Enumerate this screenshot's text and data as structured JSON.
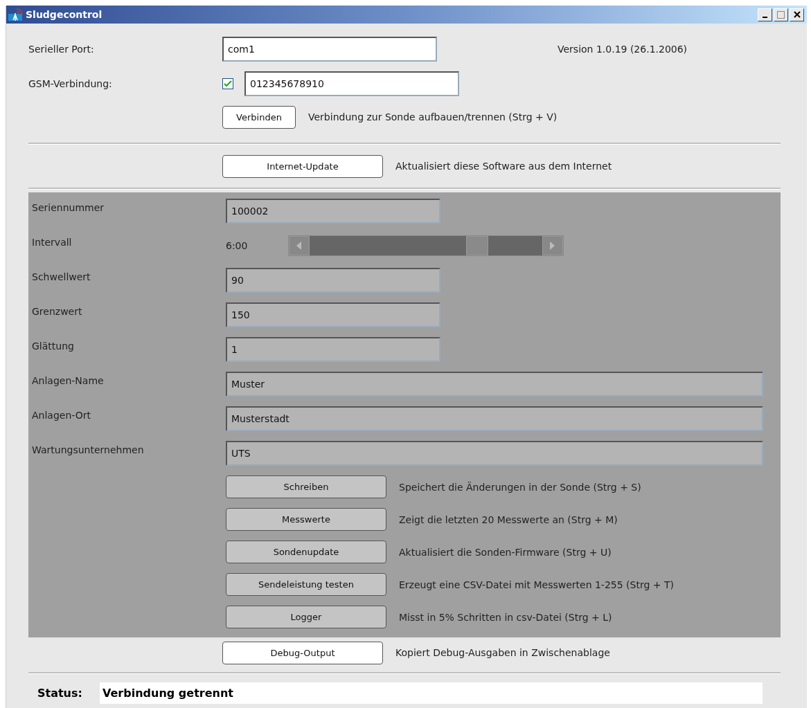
{
  "window": {
    "title": "Sludgecontrol"
  },
  "serial_port": {
    "label": "Serieller Port:",
    "value": "com1"
  },
  "version": "Version 1.0.19 (26.1.2006)",
  "gsm": {
    "label": "GSM-Verbindung:",
    "checked": true,
    "value": "012345678910"
  },
  "connect": {
    "button": "Verbinden",
    "description": "Verbindung zur Sonde aufbauen/trennen (Strg + V)"
  },
  "update": {
    "button": "Internet-Update",
    "description": "Aktualisiert diese Software aus dem Internet"
  },
  "probe_fields": [
    {
      "kind": "short",
      "label": "Seriennummer",
      "value": "100002"
    },
    {
      "kind": "slider",
      "label": "Intervall",
      "reading": "6:00",
      "level": 0.72
    },
    {
      "kind": "short",
      "label": "Schwellwert",
      "value": "90"
    },
    {
      "kind": "short",
      "label": "Grenzwert",
      "value": "150"
    },
    {
      "kind": "short",
      "label": "Glättung",
      "value": "1"
    },
    {
      "kind": "long",
      "label": "Anlagen-Name",
      "value": "Muster"
    },
    {
      "kind": "long",
      "label": "Anlagen-Ort",
      "value": "Musterstadt"
    },
    {
      "kind": "long",
      "label": "Wartungsunternehmen",
      "value": "UTS"
    }
  ],
  "probe_actions": [
    {
      "button": "Schreiben",
      "description": "Speichert die Änderungen in der Sonde (Strg + S)"
    },
    {
      "button": "Messwerte",
      "description": "Zeigt die letzten 20 Messwerte an (Strg + M)"
    },
    {
      "button": "Sondenupdate",
      "description": "Aktualisiert die Sonden-Firmware (Strg + U)"
    },
    {
      "button": "Sendeleistung testen",
      "description": "Erzeugt eine CSV-Datei mit Messwerten 1-255 (Strg + T)"
    },
    {
      "button": "Logger",
      "description": "Misst in 5% Schritten in csv-Datei (Strg + L)"
    }
  ],
  "debug": {
    "button": "Debug-Output",
    "description": "Kopiert Debug-Ausgaben in Zwischenablage"
  },
  "status": {
    "label": "Status:",
    "value": "Verbindung getrennt"
  }
}
